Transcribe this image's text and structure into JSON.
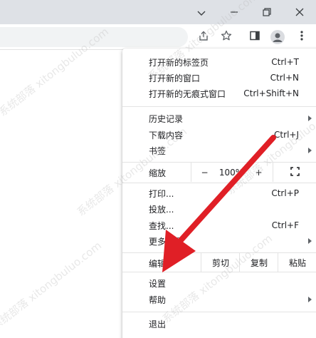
{
  "window": {
    "controls": [
      "chevron-down-icon",
      "minimize-icon",
      "restore-icon",
      "close-icon"
    ]
  },
  "toolbar": {
    "icons": [
      "share-icon",
      "star-icon",
      "side-panel-icon",
      "profile-icon",
      "more-vert-icon"
    ]
  },
  "menu": {
    "group1": [
      {
        "label": "打开新的标签页",
        "shortcut": "Ctrl+T"
      },
      {
        "label": "打开新的窗口",
        "shortcut": "Ctrl+N"
      },
      {
        "label": "打开新的无痕式窗口",
        "shortcut": "Ctrl+Shift+N"
      }
    ],
    "group2": [
      {
        "label": "历史记录",
        "shortcut": ""
      },
      {
        "label": "下载内容",
        "shortcut": "Ctrl+J"
      },
      {
        "label": "书签",
        "shortcut": ""
      }
    ],
    "zoom": {
      "label": "缩放",
      "minus": "−",
      "value": "100%",
      "plus": "+",
      "fullscreen_icon": "fullscreen-icon"
    },
    "group3": [
      {
        "label": "打印...",
        "shortcut": "Ctrl+P"
      },
      {
        "label": "投放...",
        "shortcut": ""
      },
      {
        "label": "查找...",
        "shortcut": "Ctrl+F"
      },
      {
        "label": "更多工具",
        "shortcut": ""
      }
    ],
    "edit": {
      "label": "编辑",
      "cut": "剪切",
      "copy": "复制",
      "paste": "粘贴"
    },
    "group4": [
      {
        "label": "设置",
        "shortcut": ""
      },
      {
        "label": "帮助",
        "shortcut": ""
      }
    ],
    "exit": {
      "label": "退出"
    }
  },
  "watermark": {
    "text": "系统部落 xitongbuluo.com"
  },
  "colors": {
    "arrow": "#e01f26",
    "titlebar": "#dee1e6",
    "menu_text": "#202124",
    "icon": "#5f6368"
  }
}
